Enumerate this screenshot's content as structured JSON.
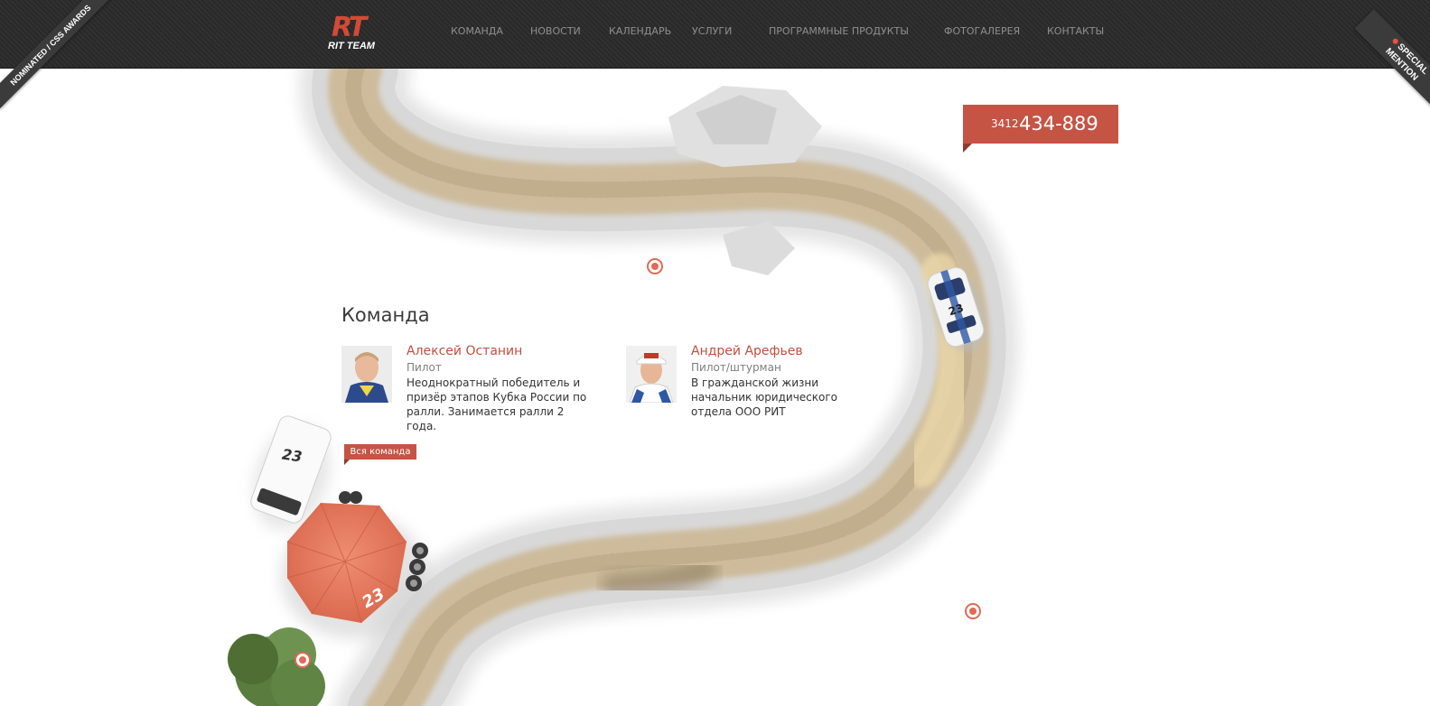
{
  "header": {
    "logo": {
      "text": "RT",
      "subtitle": "RIT TEAM"
    },
    "nav": [
      {
        "label": "КОМАНДА"
      },
      {
        "label": "НОВОСТИ"
      },
      {
        "label": "КАЛЕНДАРЬ"
      },
      {
        "label": "УСЛУГИ"
      },
      {
        "label": "ПРОГРАММНЫЕ ПРОДУКТЫ"
      },
      {
        "label": "ФОТОГАЛЕРЕЯ"
      },
      {
        "label": "КОНТАКТЫ"
      }
    ]
  },
  "ribbons": {
    "left": "NOMINATED / CSS AWARDS",
    "right_line1": "SPECIAL",
    "right_line2": "MENTION"
  },
  "phone": {
    "code": "3412",
    "number": "434-889"
  },
  "team": {
    "title": "Команда",
    "members": [
      {
        "name": "Алексей Останин",
        "role": "Пилот",
        "bio": "Неоднократный победитель и призёр этапов Кубка России по ралли. Занимается ралли 2 года."
      },
      {
        "name": "Андрей Арефьев",
        "role": "Пилот/штурман",
        "bio": "В гражданской жизни начальник юридического отдела ООО РИТ"
      }
    ],
    "all_button": "Вся команда"
  },
  "scene": {
    "car_number": "23"
  },
  "colors": {
    "accent": "#c55445",
    "header_bg": "#2a2a2a",
    "nav_text": "#8f8f8f",
    "name_text": "#c24f3f",
    "road": "#c9b79a",
    "umbrella": "#e2775c"
  }
}
